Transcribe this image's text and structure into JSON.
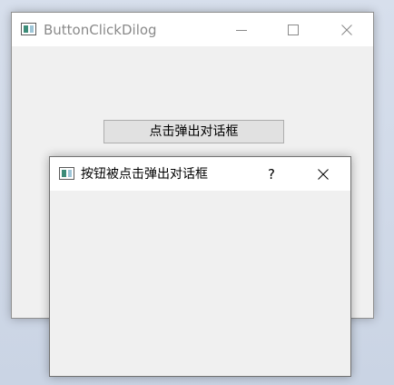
{
  "main_window": {
    "title": "ButtonClickDilog",
    "button_label": "点击弹出对话框"
  },
  "dialog": {
    "title": "按钮被点击弹出对话框",
    "help_glyph": "?"
  },
  "colors": {
    "titlebar_bg": "#ffffff",
    "window_bg": "#f0f0f0",
    "inactive_title_text": "#8a8a8a",
    "button_bg": "#e1e1e1",
    "desktop_bg": "#cfd8e6"
  },
  "icons": {
    "app": "app-window-icon",
    "minimize": "minimize-icon",
    "maximize": "maximize-icon",
    "close": "close-icon",
    "help": "help-icon"
  }
}
